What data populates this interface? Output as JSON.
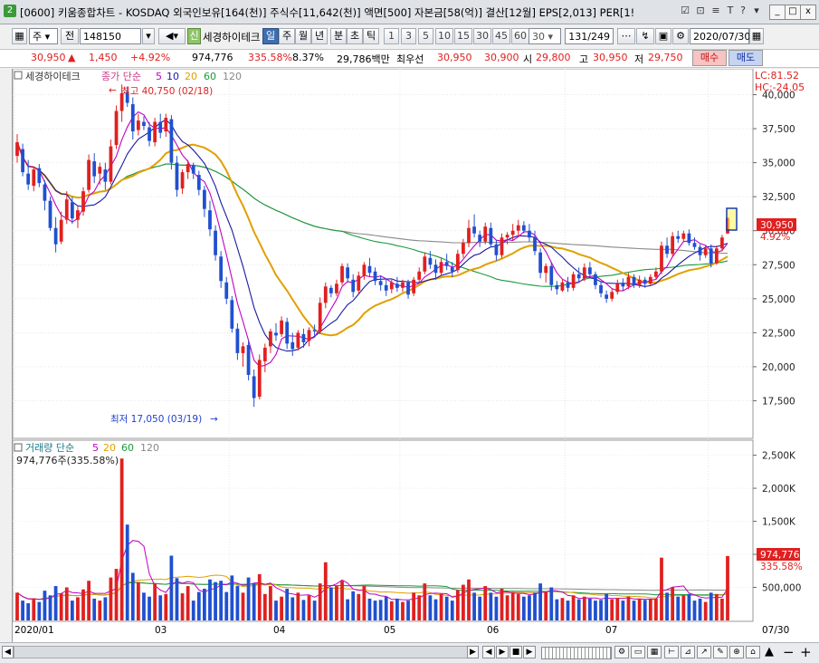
{
  "window": {
    "icon_label": "2",
    "title": "[0600] 키움종합차트 - KOSDAQ 외국인보유[164(천)] 주식수[11,642(천)] 액면[500] 자본금[58(억)] 결산[12월] EPS[2,013] PER[1!",
    "title_icons": [
      "window-list-icon",
      "link-icon",
      "list-icon",
      "text-icon",
      "tool-icon",
      "help-icon"
    ],
    "title_glyphs": [
      "☑",
      "⊡",
      "≡",
      "T",
      "?",
      "▾"
    ],
    "controls": [
      "_",
      "□",
      "x"
    ]
  },
  "toolbar": {
    "period_type": "주",
    "prev_label": "전",
    "stock_code": "148150",
    "new_badge": "신",
    "stock_name": "세경하이테크",
    "period_buttons": [
      "일",
      "주",
      "월",
      "년",
      "분",
      "초",
      "틱"
    ],
    "selected_period": "일",
    "interval_buttons": [
      "1",
      "3",
      "5",
      "10",
      "15",
      "30",
      "45",
      "60"
    ],
    "interval_value": "30",
    "count": "131/249",
    "date": "2020/07/30"
  },
  "quote": {
    "price": "30,950",
    "change_arrow": "▲",
    "change": "1,450",
    "change_pct": "+4.92%",
    "volume": "974,776",
    "volume_ratio": "335.58%",
    "turnover": "8.37%",
    "amount": "29,786백만",
    "priority_label": "최우선",
    "ask": "30,950",
    "bid": "30,900",
    "open_label": "시",
    "open": "29,800",
    "high_label": "고",
    "high": "30,950",
    "low_label": "저",
    "low": "29,750",
    "buy_label": "매수",
    "sell_label": "매도"
  },
  "price_panel": {
    "stock_label": "세경하이테크",
    "ma_label": "종가 단순",
    "ma_periods": [
      "5",
      "10",
      "20",
      "60",
      "120"
    ],
    "lc": "LC:81.52",
    "hc": "HC:-24.05",
    "high_marker": "최고 40,750 (02/18)",
    "low_marker": "최저 17,050 (03/19)",
    "last_price": "30,950",
    "last_pct": "4.92%",
    "y_ticks": [
      "40,000",
      "37,500",
      "35,000",
      "32,500",
      "30,000",
      "27,500",
      "25,000",
      "22,500",
      "20,000",
      "17,500"
    ]
  },
  "volume_panel": {
    "label": "거래량 단순",
    "ma_periods": [
      "5",
      "20",
      "60",
      "120"
    ],
    "current": "974,776주(335.58%)",
    "last_volume": "974,776",
    "last_pct": "335.58%",
    "y_ticks": [
      "2,500K",
      "2,000K",
      "1,500K",
      "1,000K",
      "500,000"
    ]
  },
  "x_axis": {
    "labels": [
      "2020/01",
      "03",
      "04",
      "05",
      "06",
      "07"
    ],
    "end_label": "07/30"
  },
  "bottom": {
    "left_arrow": "◀",
    "right_arrow": "▶",
    "nav_buttons": [
      "◀",
      "▶",
      "■",
      "▶"
    ],
    "zoom_out": "−",
    "zoom_in": "+",
    "fit": "▲"
  },
  "colors": {
    "up": "#e02020",
    "down": "#2050d0",
    "ma5": "#c000c0",
    "ma10": "#1a1aa0",
    "ma20": "#e0a000",
    "ma60": "#1a9a3a",
    "ma120": "#888888"
  },
  "chart_data": {
    "type": "candlestick",
    "ylim": [
      15000,
      41500
    ],
    "volume_ylim": [
      0,
      2700000
    ],
    "candles": [
      {
        "o": 35500,
        "h": 37100,
        "l": 35000,
        "c": 36500
      },
      {
        "o": 36000,
        "h": 36400,
        "l": 34000,
        "c": 34300
      },
      {
        "o": 34200,
        "h": 35200,
        "l": 33000,
        "c": 33400
      },
      {
        "o": 33300,
        "h": 34700,
        "l": 32900,
        "c": 34500
      },
      {
        "o": 34600,
        "h": 34900,
        "l": 33200,
        "c": 33500
      },
      {
        "o": 33400,
        "h": 33700,
        "l": 31500,
        "c": 32200
      },
      {
        "o": 32200,
        "h": 32500,
        "l": 30000,
        "c": 30200
      },
      {
        "o": 30200,
        "h": 31000,
        "l": 28400,
        "c": 29000
      },
      {
        "o": 29200,
        "h": 31400,
        "l": 29000,
        "c": 30800
      },
      {
        "o": 30800,
        "h": 32900,
        "l": 30500,
        "c": 32300
      },
      {
        "o": 32100,
        "h": 32500,
        "l": 30500,
        "c": 30900
      },
      {
        "o": 30800,
        "h": 31800,
        "l": 30200,
        "c": 31500
      },
      {
        "o": 31400,
        "h": 33200,
        "l": 31100,
        "c": 32900
      },
      {
        "o": 33000,
        "h": 35600,
        "l": 32800,
        "c": 35200
      },
      {
        "o": 35100,
        "h": 35700,
        "l": 33500,
        "c": 34000
      },
      {
        "o": 34200,
        "h": 35000,
        "l": 33400,
        "c": 34700
      },
      {
        "o": 34500,
        "h": 35000,
        "l": 33000,
        "c": 33600
      },
      {
        "o": 33600,
        "h": 36700,
        "l": 33400,
        "c": 36200
      },
      {
        "o": 36300,
        "h": 39200,
        "l": 36000,
        "c": 38800
      },
      {
        "o": 38800,
        "h": 40750,
        "l": 38000,
        "c": 40100
      },
      {
        "o": 40200,
        "h": 40600,
        "l": 39100,
        "c": 39400
      },
      {
        "o": 39300,
        "h": 39800,
        "l": 36700,
        "c": 37300
      },
      {
        "o": 37400,
        "h": 38600,
        "l": 37000,
        "c": 38100
      },
      {
        "o": 38000,
        "h": 38400,
        "l": 37400,
        "c": 37700
      },
      {
        "o": 37600,
        "h": 38000,
        "l": 36200,
        "c": 36600
      },
      {
        "o": 36500,
        "h": 38300,
        "l": 36200,
        "c": 38000
      },
      {
        "o": 38000,
        "h": 38600,
        "l": 36800,
        "c": 37200
      },
      {
        "o": 37300,
        "h": 38600,
        "l": 36900,
        "c": 38300
      },
      {
        "o": 38200,
        "h": 38500,
        "l": 34500,
        "c": 35000
      },
      {
        "o": 35000,
        "h": 35500,
        "l": 32500,
        "c": 33000
      },
      {
        "o": 33100,
        "h": 34500,
        "l": 32700,
        "c": 34300
      },
      {
        "o": 34300,
        "h": 35200,
        "l": 33800,
        "c": 34900
      },
      {
        "o": 34800,
        "h": 35000,
        "l": 33800,
        "c": 34200
      },
      {
        "o": 34100,
        "h": 34400,
        "l": 32600,
        "c": 33000
      },
      {
        "o": 33000,
        "h": 33300,
        "l": 31000,
        "c": 31600
      },
      {
        "o": 31500,
        "h": 32200,
        "l": 29600,
        "c": 30100
      },
      {
        "o": 30000,
        "h": 30400,
        "l": 27800,
        "c": 28200
      },
      {
        "o": 28100,
        "h": 28500,
        "l": 25800,
        "c": 26300
      },
      {
        "o": 26200,
        "h": 26600,
        "l": 24600,
        "c": 25000
      },
      {
        "o": 24900,
        "h": 25200,
        "l": 22500,
        "c": 22800
      },
      {
        "o": 22800,
        "h": 23200,
        "l": 20500,
        "c": 21000
      },
      {
        "o": 21000,
        "h": 21800,
        "l": 20000,
        "c": 21500
      },
      {
        "o": 21600,
        "h": 21900,
        "l": 19000,
        "c": 19400
      },
      {
        "o": 19300,
        "h": 19800,
        "l": 17050,
        "c": 17700
      },
      {
        "o": 17800,
        "h": 20900,
        "l": 17600,
        "c": 20500
      },
      {
        "o": 20400,
        "h": 21700,
        "l": 19600,
        "c": 21400
      },
      {
        "o": 21500,
        "h": 22800,
        "l": 21000,
        "c": 22600
      },
      {
        "o": 22500,
        "h": 23200,
        "l": 21900,
        "c": 22300
      },
      {
        "o": 22400,
        "h": 23700,
        "l": 22200,
        "c": 23400
      },
      {
        "o": 23300,
        "h": 23600,
        "l": 21300,
        "c": 21700
      },
      {
        "o": 21800,
        "h": 22500,
        "l": 20800,
        "c": 21300
      },
      {
        "o": 21400,
        "h": 22700,
        "l": 21200,
        "c": 22500
      },
      {
        "o": 22400,
        "h": 22800,
        "l": 21400,
        "c": 21800
      },
      {
        "o": 21900,
        "h": 22900,
        "l": 21500,
        "c": 22700
      },
      {
        "o": 22700,
        "h": 23100,
        "l": 22200,
        "c": 22600
      },
      {
        "o": 22600,
        "h": 25100,
        "l": 22400,
        "c": 24700
      },
      {
        "o": 24700,
        "h": 26200,
        "l": 24300,
        "c": 25900
      },
      {
        "o": 25800,
        "h": 26000,
        "l": 25100,
        "c": 25400
      },
      {
        "o": 25400,
        "h": 26400,
        "l": 25200,
        "c": 26100
      },
      {
        "o": 26200,
        "h": 27600,
        "l": 26000,
        "c": 27400
      },
      {
        "o": 27300,
        "h": 27600,
        "l": 26200,
        "c": 26500
      },
      {
        "o": 26400,
        "h": 26800,
        "l": 25100,
        "c": 25500
      },
      {
        "o": 25600,
        "h": 27000,
        "l": 25400,
        "c": 26700
      },
      {
        "o": 26700,
        "h": 27700,
        "l": 26400,
        "c": 27500
      },
      {
        "o": 27400,
        "h": 28000,
        "l": 26600,
        "c": 26900
      },
      {
        "o": 27000,
        "h": 27300,
        "l": 26000,
        "c": 26300
      },
      {
        "o": 26300,
        "h": 26700,
        "l": 25600,
        "c": 26000
      },
      {
        "o": 26000,
        "h": 26500,
        "l": 25200,
        "c": 25600
      },
      {
        "o": 25700,
        "h": 26400,
        "l": 25400,
        "c": 26200
      },
      {
        "o": 26100,
        "h": 26600,
        "l": 25500,
        "c": 25800
      },
      {
        "o": 25800,
        "h": 26400,
        "l": 25500,
        "c": 26200
      },
      {
        "o": 26200,
        "h": 26400,
        "l": 25000,
        "c": 25300
      },
      {
        "o": 25400,
        "h": 26600,
        "l": 25200,
        "c": 26400
      },
      {
        "o": 26400,
        "h": 27300,
        "l": 26200,
        "c": 27000
      },
      {
        "o": 27000,
        "h": 28400,
        "l": 26800,
        "c": 28100
      },
      {
        "o": 28000,
        "h": 28500,
        "l": 27200,
        "c": 27500
      },
      {
        "o": 27500,
        "h": 27900,
        "l": 26400,
        "c": 26900
      },
      {
        "o": 26900,
        "h": 28000,
        "l": 26700,
        "c": 27700
      },
      {
        "o": 27700,
        "h": 28300,
        "l": 27100,
        "c": 27400
      },
      {
        "o": 27300,
        "h": 27700,
        "l": 26600,
        "c": 27000
      },
      {
        "o": 27100,
        "h": 28600,
        "l": 26900,
        "c": 28300
      },
      {
        "o": 28300,
        "h": 29400,
        "l": 28000,
        "c": 29100
      },
      {
        "o": 29100,
        "h": 30800,
        "l": 28800,
        "c": 30200
      },
      {
        "o": 30300,
        "h": 31200,
        "l": 29500,
        "c": 29800
      },
      {
        "o": 29700,
        "h": 30000,
        "l": 28800,
        "c": 29200
      },
      {
        "o": 29200,
        "h": 30600,
        "l": 29000,
        "c": 30300
      },
      {
        "o": 30200,
        "h": 30600,
        "l": 28800,
        "c": 29000
      },
      {
        "o": 29000,
        "h": 29300,
        "l": 27800,
        "c": 28200
      },
      {
        "o": 28200,
        "h": 29800,
        "l": 28000,
        "c": 29500
      },
      {
        "o": 29500,
        "h": 29900,
        "l": 29000,
        "c": 29700
      },
      {
        "o": 29700,
        "h": 30500,
        "l": 29300,
        "c": 30000
      },
      {
        "o": 30000,
        "h": 30800,
        "l": 29600,
        "c": 30400
      },
      {
        "o": 30400,
        "h": 30700,
        "l": 29800,
        "c": 30000
      },
      {
        "o": 30000,
        "h": 30500,
        "l": 29200,
        "c": 29500
      },
      {
        "o": 29500,
        "h": 30000,
        "l": 28200,
        "c": 28500
      },
      {
        "o": 28400,
        "h": 28700,
        "l": 26500,
        "c": 26900
      },
      {
        "o": 26900,
        "h": 27600,
        "l": 26200,
        "c": 27400
      },
      {
        "o": 27400,
        "h": 27700,
        "l": 25600,
        "c": 26000
      },
      {
        "o": 26000,
        "h": 26300,
        "l": 25300,
        "c": 25700
      },
      {
        "o": 25600,
        "h": 26400,
        "l": 25500,
        "c": 26200
      },
      {
        "o": 26200,
        "h": 26600,
        "l": 25500,
        "c": 25800
      },
      {
        "o": 25800,
        "h": 27000,
        "l": 25600,
        "c": 26800
      },
      {
        "o": 26800,
        "h": 27300,
        "l": 26200,
        "c": 26500
      },
      {
        "o": 26500,
        "h": 27600,
        "l": 26300,
        "c": 27300
      },
      {
        "o": 27300,
        "h": 27700,
        "l": 26500,
        "c": 26800
      },
      {
        "o": 26800,
        "h": 27000,
        "l": 25700,
        "c": 26000
      },
      {
        "o": 26000,
        "h": 26300,
        "l": 25100,
        "c": 25400
      },
      {
        "o": 25300,
        "h": 25600,
        "l": 24700,
        "c": 25000
      },
      {
        "o": 25000,
        "h": 25700,
        "l": 24800,
        "c": 25500
      },
      {
        "o": 25500,
        "h": 26400,
        "l": 25300,
        "c": 26100
      },
      {
        "o": 26100,
        "h": 26500,
        "l": 25600,
        "c": 25900
      },
      {
        "o": 25900,
        "h": 26900,
        "l": 25700,
        "c": 26600
      },
      {
        "o": 26600,
        "h": 26800,
        "l": 25800,
        "c": 26000
      },
      {
        "o": 26000,
        "h": 26700,
        "l": 25800,
        "c": 26400
      },
      {
        "o": 26400,
        "h": 26600,
        "l": 25800,
        "c": 26100
      },
      {
        "o": 26100,
        "h": 26800,
        "l": 26000,
        "c": 26600
      },
      {
        "o": 26600,
        "h": 27300,
        "l": 26400,
        "c": 27000
      },
      {
        "o": 27000,
        "h": 29200,
        "l": 26800,
        "c": 28900
      },
      {
        "o": 28900,
        "h": 29500,
        "l": 28000,
        "c": 28300
      },
      {
        "o": 28300,
        "h": 29900,
        "l": 28100,
        "c": 29600
      },
      {
        "o": 29600,
        "h": 30000,
        "l": 29100,
        "c": 29400
      },
      {
        "o": 29400,
        "h": 30000,
        "l": 29200,
        "c": 29800
      },
      {
        "o": 29800,
        "h": 30100,
        "l": 28900,
        "c": 29100
      },
      {
        "o": 29100,
        "h": 29500,
        "l": 28600,
        "c": 28800
      },
      {
        "o": 28800,
        "h": 29000,
        "l": 27800,
        "c": 28200
      },
      {
        "o": 28200,
        "h": 28900,
        "l": 28000,
        "c": 28700
      },
      {
        "o": 28700,
        "h": 29000,
        "l": 27300,
        "c": 27600
      },
      {
        "o": 27600,
        "h": 28900,
        "l": 27500,
        "c": 28700
      },
      {
        "o": 28700,
        "h": 29700,
        "l": 28500,
        "c": 29500
      },
      {
        "o": 29800,
        "h": 30950,
        "l": 29750,
        "c": 30950
      }
    ],
    "volumes": [
      420000,
      300000,
      260000,
      330000,
      280000,
      450000,
      380000,
      520000,
      410000,
      500000,
      300000,
      350000,
      470000,
      600000,
      330000,
      300000,
      350000,
      650000,
      780000,
      2450000,
      1450000,
      720000,
      580000,
      420000,
      360000,
      560000,
      380000,
      400000,
      980000,
      640000,
      410000,
      520000,
      300000,
      430000,
      480000,
      620000,
      580000,
      600000,
      430000,
      680000,
      520000,
      420000,
      650000,
      560000,
      700000,
      400000,
      520000,
      300000,
      360000,
      480000,
      350000,
      420000,
      310000,
      380000,
      300000,
      560000,
      880000,
      500000,
      520000,
      600000,
      320000,
      440000,
      400000,
      520000,
      330000,
      300000,
      310000,
      360000,
      290000,
      330000,
      280000,
      300000,
      420000,
      380000,
      560000,
      380000,
      320000,
      400000,
      360000,
      300000,
      460000,
      540000,
      620000,
      420000,
      360000,
      520000,
      420000,
      360000,
      480000,
      380000,
      430000,
      400000,
      360000,
      380000,
      420000,
      560000,
      430000,
      500000,
      320000,
      340000,
      300000,
      380000,
      320000,
      360000,
      330000,
      300000,
      310000,
      400000,
      320000,
      340000,
      300000,
      360000,
      300000,
      330000,
      310000,
      320000,
      330000,
      950000,
      420000,
      500000,
      360000,
      380000,
      400000,
      300000,
      330000,
      280000,
      420000,
      400000,
      330000,
      974776
    ]
  }
}
